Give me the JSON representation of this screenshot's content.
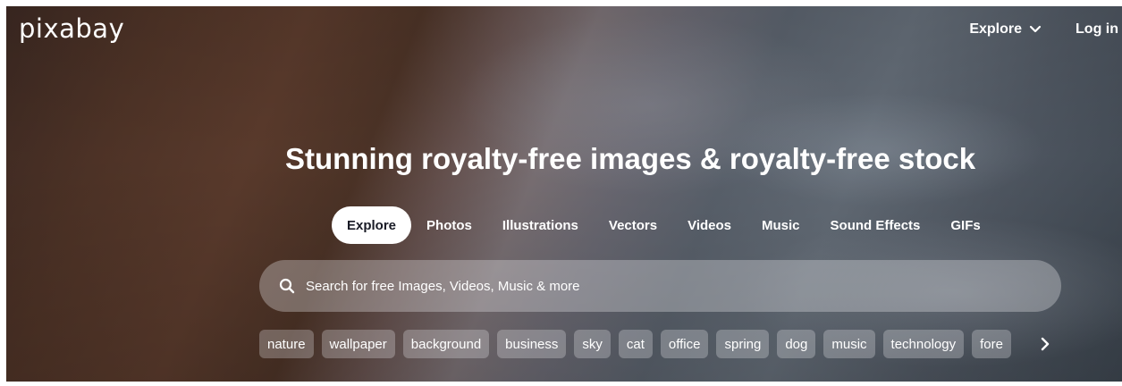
{
  "header": {
    "logo": "pixabay",
    "nav": {
      "explore_label": "Explore",
      "login_label": "Log in"
    }
  },
  "hero": {
    "headline": "Stunning royalty-free images & royalty-free stock"
  },
  "tabs": [
    {
      "label": "Explore",
      "active": true
    },
    {
      "label": "Photos",
      "active": false
    },
    {
      "label": "Illustrations",
      "active": false
    },
    {
      "label": "Vectors",
      "active": false
    },
    {
      "label": "Videos",
      "active": false
    },
    {
      "label": "Music",
      "active": false
    },
    {
      "label": "Sound Effects",
      "active": false
    },
    {
      "label": "GIFs",
      "active": false
    }
  ],
  "search": {
    "placeholder": "Search for free Images, Videos, Music & more",
    "icon": "search-icon"
  },
  "tags": [
    "nature",
    "wallpaper",
    "background",
    "business",
    "sky",
    "cat",
    "office",
    "spring",
    "dog",
    "music",
    "technology",
    "fore"
  ],
  "tags_next_icon": "chevron-right-icon",
  "colors": {
    "text": "#ffffff",
    "active_tab_bg": "#ffffff",
    "active_tab_text": "#191b26"
  }
}
